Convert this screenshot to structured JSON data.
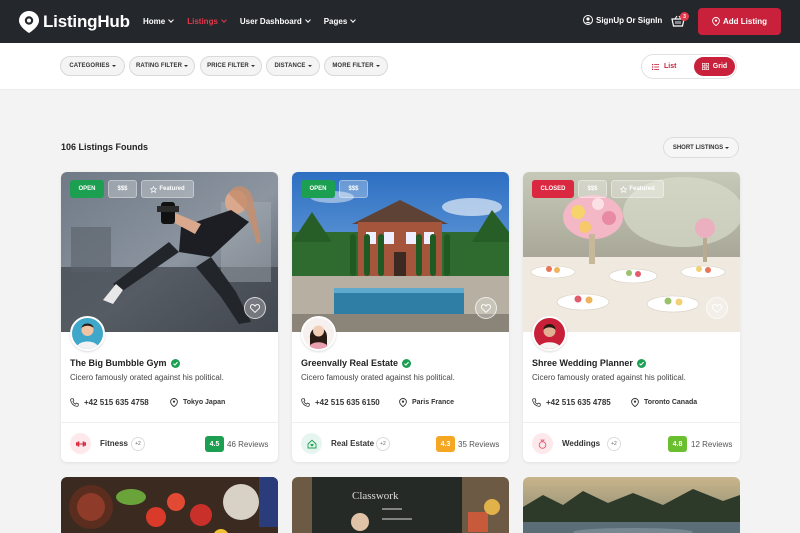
{
  "brand": {
    "name": "ListingHub"
  },
  "nav": {
    "home": "Home",
    "listings": "Listings",
    "user_dashboard": "User Dashboard",
    "pages": "Pages"
  },
  "header": {
    "signup": "SignUp Or SignIn",
    "cart_count": "3",
    "add_listing": "Add Listing"
  },
  "filters": {
    "categories": "CATEGORIES",
    "rating": "RATING FILTER",
    "price": "PRICE FILTER",
    "distance": "DISTANCE",
    "more": "MORE FILTER"
  },
  "view": {
    "list": "List",
    "grid": "Grid",
    "selected": "Grid"
  },
  "results": {
    "count_text": "106 Listings Founds",
    "sort_label": "SHORT LISTINGS"
  },
  "listings": [
    {
      "status": "OPEN",
      "price": "$$$",
      "featured": "Featured",
      "title": "The Big Bumbble Gym",
      "description": "Cicero famously orated against his political.",
      "phone": "+42 515 635 4758",
      "location": "Tokyo Japan",
      "category": "Fitness",
      "more_categories": "+2",
      "rating": "4.5",
      "reviews": "46 Reviews",
      "rating_color": "#1d9f52"
    },
    {
      "status": "OPEN",
      "price": "$$$",
      "title": "Greenvally Real Estate",
      "description": "Cicero famously orated against his political.",
      "phone": "+42 515 635 6150",
      "location": "Paris France",
      "category": "Real Estate",
      "more_categories": "+2",
      "rating": "4.3",
      "reviews": "35 Reviews",
      "rating_color": "#f5a623"
    },
    {
      "status": "CLOSED",
      "price": "$$$",
      "featured": "Featured",
      "title": "Shree Wedding Planner",
      "description": "Cicero famously orated against his political.",
      "phone": "+42 515 635 4785",
      "location": "Toronto Canada",
      "category": "Weddings",
      "more_categories": "+2",
      "rating": "4.8",
      "reviews": "12 Reviews",
      "rating_color": "#6abf2e"
    }
  ],
  "colors": {
    "accent": "#c9213b",
    "header_bg": "#24272c",
    "open": "#1d9f52",
    "closed": "#d9283f"
  }
}
